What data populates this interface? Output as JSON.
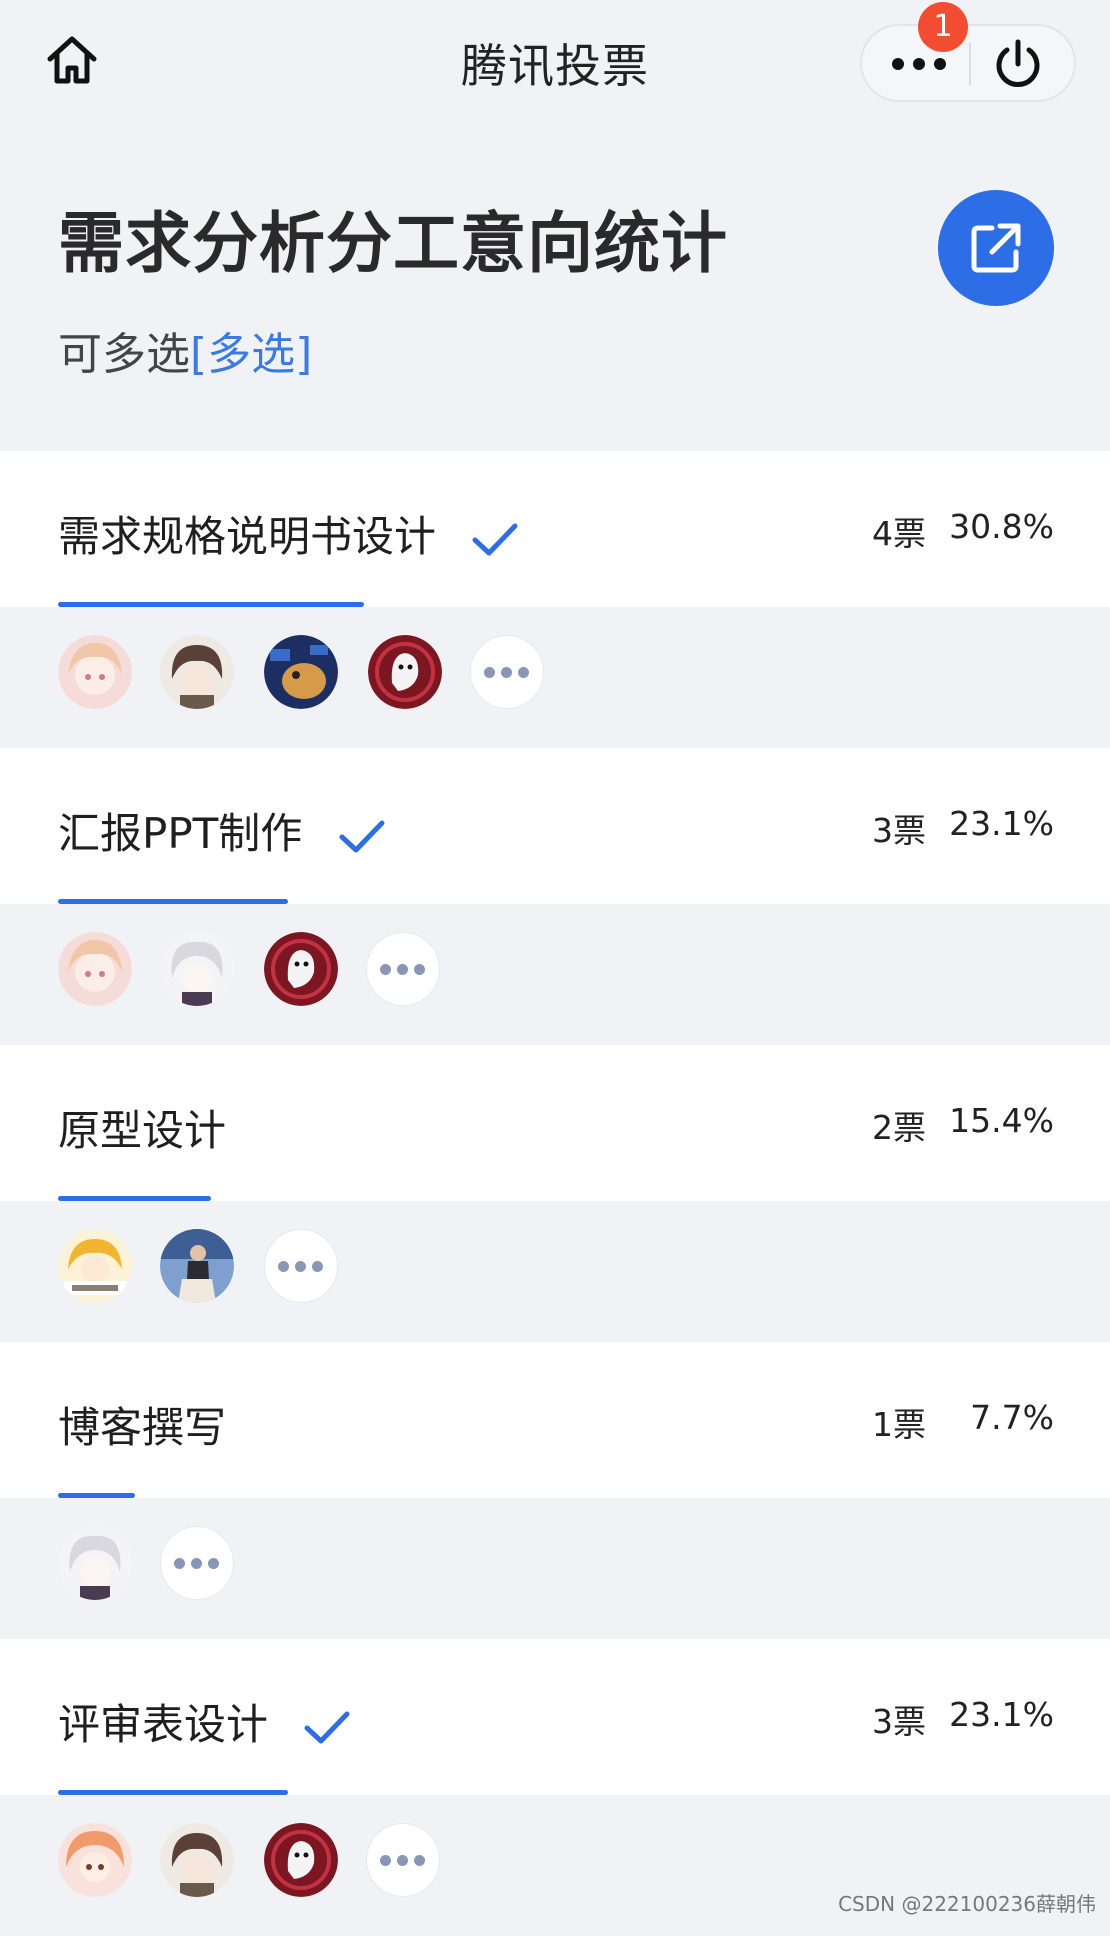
{
  "header": {
    "app_title": "腾讯投票",
    "badge_count": "1",
    "home_icon": "home-icon",
    "more_icon": "more-dots-icon",
    "power_icon": "power-icon"
  },
  "poll": {
    "title": "需求分析分工意向统计",
    "subtitle": "可多选",
    "subtitle_tag": "[多选]",
    "share_icon": "share-external-icon"
  },
  "options": [
    {
      "label": "需求规格说明书设计",
      "checked": true,
      "votes": "4票",
      "percent": "30.8%",
      "fill": 0.308
    },
    {
      "label": "汇报PPT制作",
      "checked": true,
      "votes": "3票",
      "percent": "23.1%",
      "fill": 0.231
    },
    {
      "label": "原型设计",
      "checked": false,
      "votes": "2票",
      "percent": "15.4%",
      "fill": 0.154
    },
    {
      "label": "博客撰写",
      "checked": false,
      "votes": "1票",
      "percent": "7.7%",
      "fill": 0.077
    },
    {
      "label": "评审表设计",
      "checked": true,
      "votes": "3票",
      "percent": "23.1%",
      "fill": 0.231
    }
  ],
  "colors": {
    "accent": "#2d6ee6",
    "badge": "#f24c33",
    "background": "#f1f2f6"
  },
  "watermark": "CSDN @222100236薛朝伟"
}
